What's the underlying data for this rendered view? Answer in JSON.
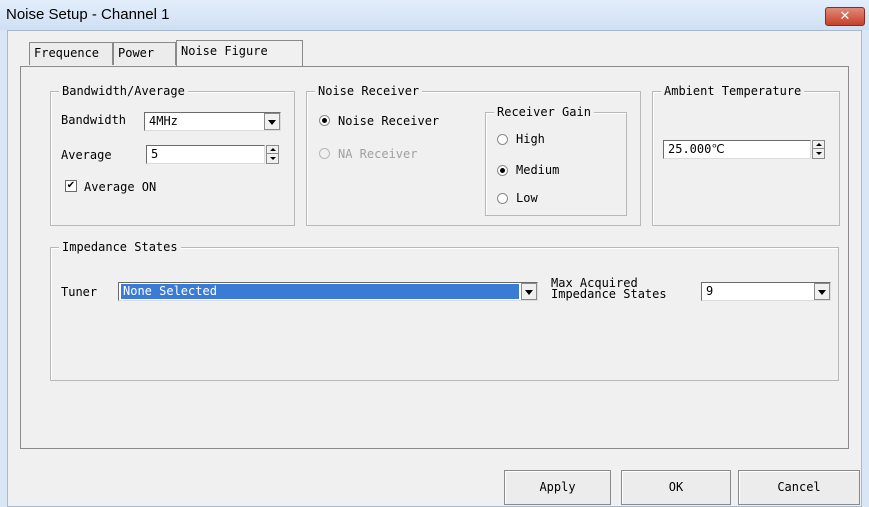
{
  "window": {
    "title": "Noise Setup - Channel 1",
    "close_glyph": "✕"
  },
  "tabs": [
    {
      "label": "Frequence"
    },
    {
      "label": "Power"
    },
    {
      "label": "Noise Figure"
    }
  ],
  "bandwidth_average": {
    "legend": "Bandwidth/Average",
    "bandwidth_label": "Bandwidth",
    "bandwidth_value": "4MHz",
    "average_label": "Average",
    "average_value": "5",
    "average_on_label": "Average ON",
    "average_on_checked": true,
    "check_glyph": "✔"
  },
  "noise_receiver": {
    "legend": "Noise Receiver",
    "noise_receiver_label": "Noise Receiver",
    "noise_receiver_selected": true,
    "na_receiver_label": "NA Receiver",
    "na_receiver_enabled": false
  },
  "receiver_gain": {
    "legend": "Receiver Gain",
    "options": [
      {
        "label": "High",
        "selected": false
      },
      {
        "label": "Medium",
        "selected": true
      },
      {
        "label": "Low",
        "selected": false
      }
    ]
  },
  "ambient_temperature": {
    "legend": "Ambient Temperature",
    "value": "25.000℃"
  },
  "impedance_states": {
    "legend": "Impedance States",
    "tuner_label": "Tuner",
    "tuner_value": "None Selected",
    "max_label_line1": "Max Acquired",
    "max_label_line2": "Impedance States",
    "max_value": "9"
  },
  "buttons": {
    "apply": "Apply",
    "ok": "OK",
    "cancel": "Cancel"
  },
  "colors": {
    "tuner_selection": "#3a7bd5",
    "title_bar": "#d9e6f6",
    "close_button": "#c7402a"
  }
}
